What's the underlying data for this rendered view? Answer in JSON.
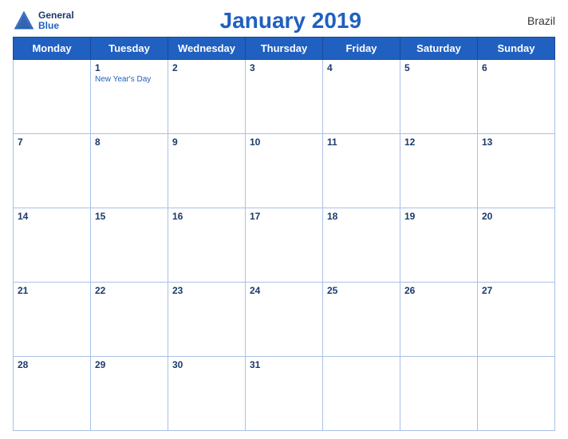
{
  "header": {
    "logo_general": "General",
    "logo_blue": "Blue",
    "title": "January 2019",
    "country": "Brazil"
  },
  "days_of_week": [
    "Monday",
    "Tuesday",
    "Wednesday",
    "Thursday",
    "Friday",
    "Saturday",
    "Sunday"
  ],
  "weeks": [
    [
      {
        "num": "",
        "holiday": ""
      },
      {
        "num": "1",
        "holiday": "New Year's Day"
      },
      {
        "num": "2",
        "holiday": ""
      },
      {
        "num": "3",
        "holiday": ""
      },
      {
        "num": "4",
        "holiday": ""
      },
      {
        "num": "5",
        "holiday": ""
      },
      {
        "num": "6",
        "holiday": ""
      }
    ],
    [
      {
        "num": "7",
        "holiday": ""
      },
      {
        "num": "8",
        "holiday": ""
      },
      {
        "num": "9",
        "holiday": ""
      },
      {
        "num": "10",
        "holiday": ""
      },
      {
        "num": "11",
        "holiday": ""
      },
      {
        "num": "12",
        "holiday": ""
      },
      {
        "num": "13",
        "holiday": ""
      }
    ],
    [
      {
        "num": "14",
        "holiday": ""
      },
      {
        "num": "15",
        "holiday": ""
      },
      {
        "num": "16",
        "holiday": ""
      },
      {
        "num": "17",
        "holiday": ""
      },
      {
        "num": "18",
        "holiday": ""
      },
      {
        "num": "19",
        "holiday": ""
      },
      {
        "num": "20",
        "holiday": ""
      }
    ],
    [
      {
        "num": "21",
        "holiday": ""
      },
      {
        "num": "22",
        "holiday": ""
      },
      {
        "num": "23",
        "holiday": ""
      },
      {
        "num": "24",
        "holiday": ""
      },
      {
        "num": "25",
        "holiday": ""
      },
      {
        "num": "26",
        "holiday": ""
      },
      {
        "num": "27",
        "holiday": ""
      }
    ],
    [
      {
        "num": "28",
        "holiday": ""
      },
      {
        "num": "29",
        "holiday": ""
      },
      {
        "num": "30",
        "holiday": ""
      },
      {
        "num": "31",
        "holiday": ""
      },
      {
        "num": "",
        "holiday": ""
      },
      {
        "num": "",
        "holiday": ""
      },
      {
        "num": "",
        "holiday": ""
      }
    ]
  ]
}
